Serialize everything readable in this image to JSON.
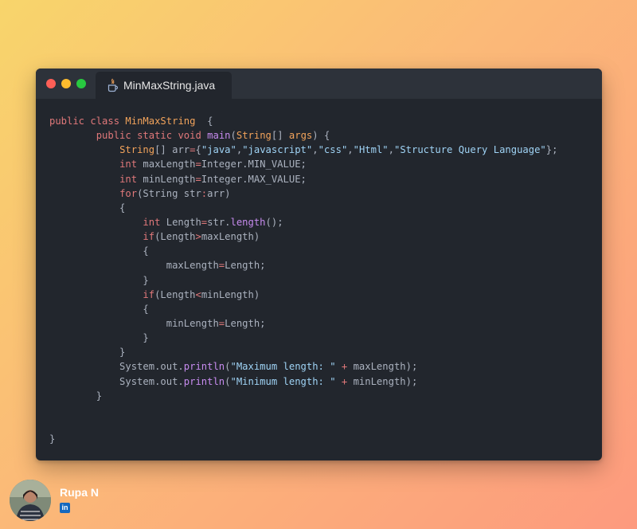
{
  "window": {
    "tab_title": "MinMaxString.java",
    "tab_icon": "java-icon",
    "controls": [
      "close",
      "minimize",
      "maximize"
    ]
  },
  "code_lines": [
    [
      [
        "kw",
        "public"
      ],
      [
        "plain",
        " "
      ],
      [
        "kw",
        "class"
      ],
      [
        "plain",
        " "
      ],
      [
        "cls",
        "MinMaxString"
      ],
      [
        "plain",
        "  {"
      ]
    ],
    [
      [
        "plain",
        "        "
      ],
      [
        "kw",
        "public"
      ],
      [
        "plain",
        " "
      ],
      [
        "kw",
        "static"
      ],
      [
        "plain",
        " "
      ],
      [
        "kw",
        "void"
      ],
      [
        "plain",
        " "
      ],
      [
        "fn",
        "main"
      ],
      [
        "plain",
        "("
      ],
      [
        "cls",
        "String"
      ],
      [
        "plain",
        "[] "
      ],
      [
        "cls",
        "args"
      ],
      [
        "plain",
        ") {"
      ]
    ],
    [
      [
        "plain",
        "            "
      ],
      [
        "cls",
        "String"
      ],
      [
        "plain",
        "[] arr"
      ],
      [
        "op",
        "="
      ],
      [
        "plain",
        "{"
      ],
      [
        "str",
        "\"java\""
      ],
      [
        "plain",
        ","
      ],
      [
        "str",
        "\"javascript\""
      ],
      [
        "plain",
        ","
      ],
      [
        "str",
        "\"css\""
      ],
      [
        "plain",
        ","
      ],
      [
        "str",
        "\"Html\""
      ],
      [
        "plain",
        ","
      ],
      [
        "str",
        "\"Structure Query Language\""
      ],
      [
        "plain",
        "};"
      ]
    ],
    [
      [
        "plain",
        "            "
      ],
      [
        "kw",
        "int"
      ],
      [
        "plain",
        " maxLength"
      ],
      [
        "op",
        "="
      ],
      [
        "plain",
        "Integer.MIN_VALUE;"
      ]
    ],
    [
      [
        "plain",
        "            "
      ],
      [
        "kw",
        "int"
      ],
      [
        "plain",
        " minLength"
      ],
      [
        "op",
        "="
      ],
      [
        "plain",
        "Integer.MAX_VALUE;"
      ]
    ],
    [
      [
        "plain",
        "            "
      ],
      [
        "kw",
        "for"
      ],
      [
        "plain",
        "(String str"
      ],
      [
        "op",
        ":"
      ],
      [
        "plain",
        "arr)"
      ]
    ],
    [
      [
        "plain",
        "            {"
      ]
    ],
    [
      [
        "plain",
        "                "
      ],
      [
        "kw",
        "int"
      ],
      [
        "plain",
        " Length"
      ],
      [
        "op",
        "="
      ],
      [
        "plain",
        "str."
      ],
      [
        "fn",
        "length"
      ],
      [
        "plain",
        "();"
      ]
    ],
    [
      [
        "plain",
        "                "
      ],
      [
        "kw",
        "if"
      ],
      [
        "plain",
        "(Length"
      ],
      [
        "op",
        ">"
      ],
      [
        "plain",
        "maxLength)"
      ]
    ],
    [
      [
        "plain",
        "                {"
      ]
    ],
    [
      [
        "plain",
        "                    maxLength"
      ],
      [
        "op",
        "="
      ],
      [
        "plain",
        "Length;"
      ]
    ],
    [
      [
        "plain",
        "                }"
      ]
    ],
    [
      [
        "plain",
        "                "
      ],
      [
        "kw",
        "if"
      ],
      [
        "plain",
        "(Length"
      ],
      [
        "op",
        "<"
      ],
      [
        "plain",
        "minLength)"
      ]
    ],
    [
      [
        "plain",
        "                {"
      ]
    ],
    [
      [
        "plain",
        "                    minLength"
      ],
      [
        "op",
        "="
      ],
      [
        "plain",
        "Length;"
      ]
    ],
    [
      [
        "plain",
        "                }"
      ]
    ],
    [
      [
        "plain",
        "            }"
      ]
    ],
    [
      [
        "plain",
        "            System.out."
      ],
      [
        "fn",
        "println"
      ],
      [
        "plain",
        "("
      ],
      [
        "str",
        "\"Maximum length: \""
      ],
      [
        "plain",
        " "
      ],
      [
        "op",
        "+"
      ],
      [
        "plain",
        " maxLength);"
      ]
    ],
    [
      [
        "plain",
        "            System.out."
      ],
      [
        "fn",
        "println"
      ],
      [
        "plain",
        "("
      ],
      [
        "str",
        "\"Minimum length: \""
      ],
      [
        "plain",
        " "
      ],
      [
        "op",
        "+"
      ],
      [
        "plain",
        " minLength);"
      ]
    ],
    [
      [
        "plain",
        "        }"
      ]
    ],
    [
      [
        "plain",
        ""
      ]
    ],
    [
      [
        "plain",
        ""
      ]
    ],
    [
      [
        "plain",
        "}"
      ]
    ]
  ],
  "author": {
    "name": "Rupa N",
    "avatar_icon": "avatar",
    "social_icon": "linkedin-icon",
    "social_label": "in"
  },
  "colors": {
    "keyword": "#e0787a",
    "class": "#f2a35b",
    "function": "#c78bef",
    "string": "#9fd3f5",
    "plain": "#abb2bf",
    "editor_bg": "#22262d",
    "titlebar_bg": "#2d323a"
  }
}
